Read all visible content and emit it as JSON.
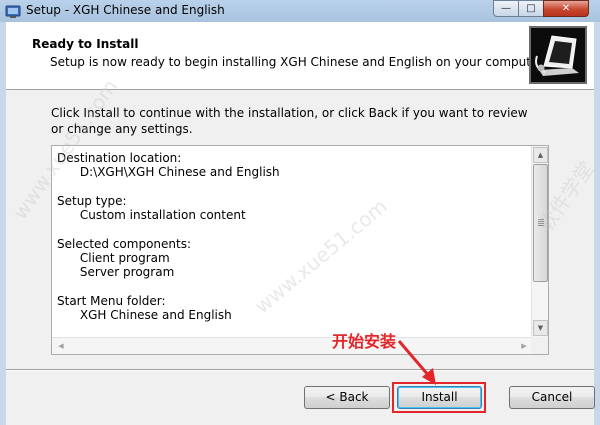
{
  "window": {
    "title": "Setup - XGH Chinese and English"
  },
  "header": {
    "title": "Ready to Install",
    "subtitle": "Setup is now ready to begin installing XGH Chinese and English on your computer."
  },
  "body": {
    "instruction": "Click Install to continue with the installation, or click Back if you want to review or change any settings."
  },
  "summary": {
    "lines": [
      "Destination location:",
      "      D:\\XGH\\XGH Chinese and English",
      "",
      "Setup type:",
      "      Custom installation content",
      "",
      "Selected components:",
      "      Client program",
      "      Server program",
      "",
      "Start Menu folder:",
      "      XGH Chinese and English"
    ]
  },
  "buttons": {
    "back": "< Back",
    "install": "Install",
    "cancel": "Cancel"
  },
  "annotation": {
    "label": "开始安装",
    "color": "#e3262a"
  },
  "watermark": {
    "text": "www.xue51.com",
    "cn": "软件学堂"
  },
  "icons": {
    "app": "setup-app-icon",
    "header": "computer-install-icon"
  }
}
